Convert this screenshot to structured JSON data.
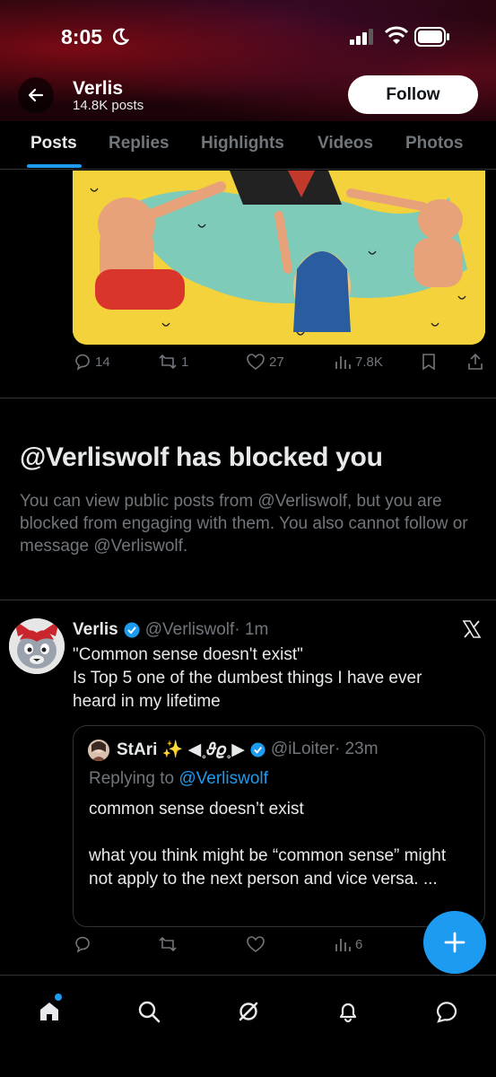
{
  "status_bar": {
    "time": "8:05"
  },
  "header": {
    "name": "Verlis",
    "posts_count": "14.8K posts",
    "follow_label": "Follow"
  },
  "tabs": [
    {
      "label": "Posts",
      "active": true
    },
    {
      "label": "Replies"
    },
    {
      "label": "Highlights"
    },
    {
      "label": "Videos"
    },
    {
      "label": "Photos"
    }
  ],
  "first_post_actions": {
    "replies": "14",
    "reposts": "1",
    "likes": "27",
    "views": "7.8K"
  },
  "blocked_notice": {
    "title": "@Verliswolf has blocked you",
    "text": "You can view public posts from @Verliswolf, but you are blocked from engaging with them. You also cannot follow or message @Verliswolf."
  },
  "tweet": {
    "name": "Verlis",
    "handle": "@Verliswolf",
    "time": "· 1m",
    "line1": "\"Common sense doesn't exist\"",
    "line2": "Is Top 5 one of the dumbest things I have ever heard in my lifetime",
    "views": "6"
  },
  "quote": {
    "name": "StAri ✨ ◀︎˳𝜗𝜚˳▶︎",
    "handle": "@iLoiter",
    "time": "· 23m",
    "replying_prefix": "Replying to ",
    "replying_to": "@Verliswolf",
    "body1": "common sense doesn’t exist",
    "body2": "what you think might be “common sense” might not apply to the next person and vice versa. ..."
  },
  "colors": {
    "accent": "#1d9bf0",
    "muted": "#71767b",
    "text": "#e7e9ea",
    "border": "#2f3336"
  },
  "icons": [
    "back-arrow-icon",
    "reply-icon",
    "repost-icon",
    "like-icon",
    "views-icon",
    "bookmark-icon",
    "share-icon",
    "verified-icon",
    "x-logo-icon",
    "compose-plus-icon",
    "home-icon",
    "search-icon",
    "grok-icon",
    "notifications-icon",
    "messages-icon"
  ]
}
